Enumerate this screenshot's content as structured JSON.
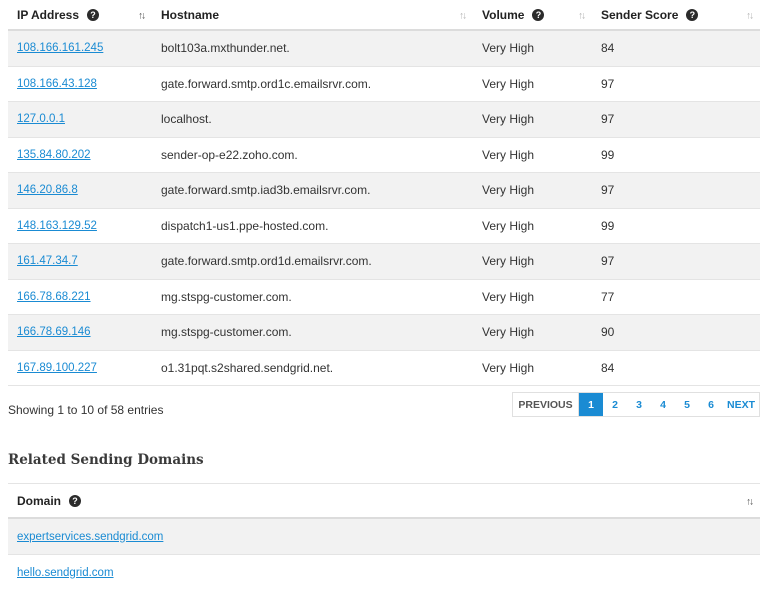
{
  "table": {
    "headers": {
      "ip": "IP Address",
      "hostname": "Hostname",
      "volume": "Volume",
      "score": "Sender Score"
    },
    "rows": [
      {
        "ip": "108.166.161.245",
        "hostname": "bolt103a.mxthunder.net.",
        "volume": "Very High",
        "score": "84"
      },
      {
        "ip": "108.166.43.128",
        "hostname": "gate.forward.smtp.ord1c.emailsrvr.com.",
        "volume": "Very High",
        "score": "97"
      },
      {
        "ip": "127.0.0.1",
        "hostname": "localhost.",
        "volume": "Very High",
        "score": "97"
      },
      {
        "ip": "135.84.80.202",
        "hostname": "sender-op-e22.zoho.com.",
        "volume": "Very High",
        "score": "99"
      },
      {
        "ip": "146.20.86.8",
        "hostname": "gate.forward.smtp.iad3b.emailsrvr.com.",
        "volume": "Very High",
        "score": "97"
      },
      {
        "ip": "148.163.129.52",
        "hostname": "dispatch1-us1.ppe-hosted.com.",
        "volume": "Very High",
        "score": "99"
      },
      {
        "ip": "161.47.34.7",
        "hostname": "gate.forward.smtp.ord1d.emailsrvr.com.",
        "volume": "Very High",
        "score": "97"
      },
      {
        "ip": "166.78.68.221",
        "hostname": "mg.stspg-customer.com.",
        "volume": "Very High",
        "score": "77"
      },
      {
        "ip": "166.78.69.146",
        "hostname": "mg.stspg-customer.com.",
        "volume": "Very High",
        "score": "90"
      },
      {
        "ip": "167.89.100.227",
        "hostname": "o1.31pqt.s2shared.sendgrid.net.",
        "volume": "Very High",
        "score": "84"
      }
    ]
  },
  "footer": {
    "info": "Showing 1 to 10 of 58 entries",
    "prev": "PREVIOUS",
    "next": "NEXT",
    "pages": [
      "1",
      "2",
      "3",
      "4",
      "5",
      "6"
    ],
    "current_page": "1"
  },
  "related": {
    "title": "Related Sending Domains",
    "header": "Domain",
    "rows": [
      "expertservices.sendgrid.com",
      "hello.sendgrid.com"
    ]
  },
  "icons": {
    "help": "help-circle-icon",
    "sort": "sort-arrows-icon"
  },
  "colors": {
    "link": "#1a8bd3",
    "row_alt": "#f2f2f2",
    "active_page": "#1a8bd3"
  }
}
